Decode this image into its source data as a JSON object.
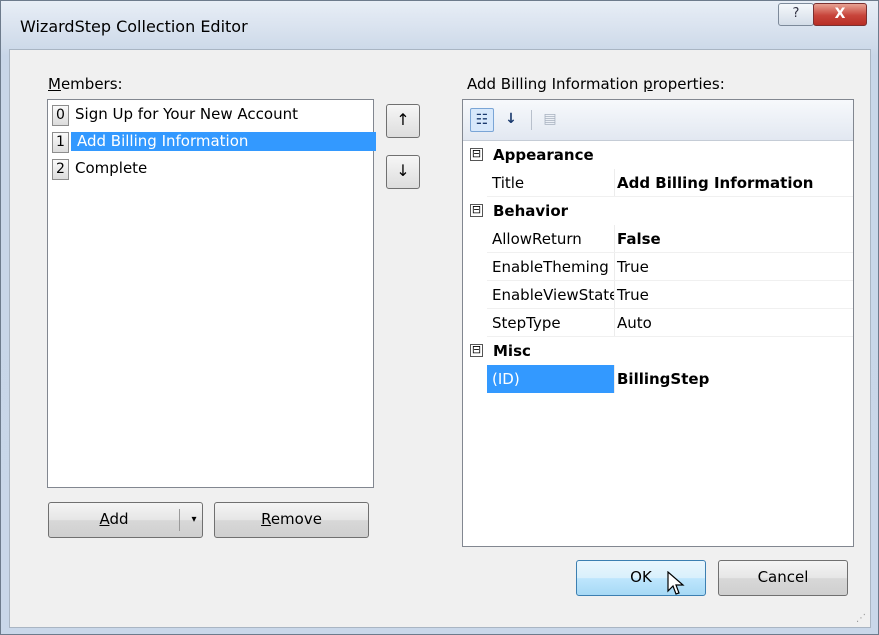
{
  "window": {
    "title": "WizardStep Collection Editor",
    "help_label": "?",
    "close_label": "X"
  },
  "members": {
    "label": "Members:",
    "items": [
      {
        "index": "0",
        "text": "Sign Up for Your New Account",
        "selected": false
      },
      {
        "index": "1",
        "text": "Add Billing Information",
        "selected": true
      },
      {
        "index": "2",
        "text": "Complete",
        "selected": false
      }
    ],
    "move_up_label": "↑",
    "move_down_label": "↓",
    "add_label": "Add",
    "remove_label": "Remove",
    "add_dropdown_label": "▾"
  },
  "properties": {
    "label": "Add Billing Information properties:",
    "toolbar": {
      "categorized_icon": "categorized-icon",
      "alphabetical_icon": "sort-az-icon",
      "property_pages_icon": "property-pages-icon"
    },
    "categories": [
      {
        "name": "Appearance",
        "expander": "⊟",
        "props": [
          {
            "name": "Title",
            "value": "Add Billing Information",
            "bold": true,
            "selected": false
          }
        ]
      },
      {
        "name": "Behavior",
        "expander": "⊟",
        "props": [
          {
            "name": "AllowReturn",
            "value": "False",
            "bold": true,
            "selected": false
          },
          {
            "name": "EnableTheming",
            "value": "True",
            "bold": false,
            "selected": false
          },
          {
            "name": "EnableViewState",
            "value": "True",
            "bold": false,
            "selected": false
          },
          {
            "name": "StepType",
            "value": "Auto",
            "bold": false,
            "selected": false
          }
        ]
      },
      {
        "name": "Misc",
        "expander": "⊟",
        "props": [
          {
            "name": "(ID)",
            "value": "BillingStep",
            "bold": true,
            "selected": true
          }
        ]
      }
    ]
  },
  "footer": {
    "ok_label": "OK",
    "cancel_label": "Cancel"
  },
  "colors": {
    "selection": "#3399ff",
    "close_button": "#c7443a"
  }
}
